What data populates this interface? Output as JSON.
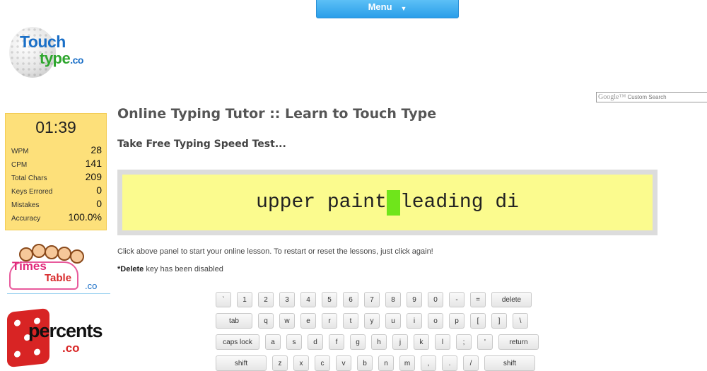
{
  "menu": {
    "label": "Menu",
    "arrow": "▼"
  },
  "logo": {
    "line1": "Touch",
    "line2": "type",
    "suffix": ".co"
  },
  "search": {
    "brand": "Google™",
    "placeholder": "Custom Search"
  },
  "stats": {
    "timer": "01:39",
    "rows": [
      {
        "label": "WPM",
        "value": "28"
      },
      {
        "label": "CPM",
        "value": "141"
      },
      {
        "label": "Total Chars",
        "value": "209"
      },
      {
        "label": "Keys Errored",
        "value": "0"
      },
      {
        "label": "Mistakes",
        "value": "0"
      },
      {
        "label": "Accuracy",
        "value": "100.0%"
      }
    ]
  },
  "ads": {
    "times_table": {
      "word1": "Times",
      "word2": "Table",
      "suffix": ".co"
    },
    "percents": {
      "word": "percents",
      "suffix": ".co"
    }
  },
  "main": {
    "title": "Online Typing Tutor :: Learn to Touch Type",
    "subtitle": "Take Free Typing Speed Test...",
    "typed_before": "upper paint",
    "typed_after": "leading di",
    "hint": "Click above panel to start your online lesson. To restart or reset the lessons, just click again!",
    "note_bold": "*Delete",
    "note_rest": " key has been disabled"
  },
  "keyboard": {
    "rows": [
      [
        "`",
        "1",
        "2",
        "3",
        "4",
        "5",
        "6",
        "7",
        "8",
        "9",
        "0",
        "-",
        "=",
        "delete"
      ],
      [
        "tab",
        "q",
        "w",
        "e",
        "r",
        "t",
        "y",
        "u",
        "i",
        "o",
        "p",
        "[",
        "]",
        "\\"
      ],
      [
        "caps lock",
        "a",
        "s",
        "d",
        "f",
        "g",
        "h",
        "j",
        "k",
        "l",
        ";",
        "'",
        "return"
      ],
      [
        "shift",
        "z",
        "x",
        "c",
        "v",
        "b",
        "n",
        "m",
        ",",
        ".",
        "/",
        "shift"
      ]
    ]
  }
}
